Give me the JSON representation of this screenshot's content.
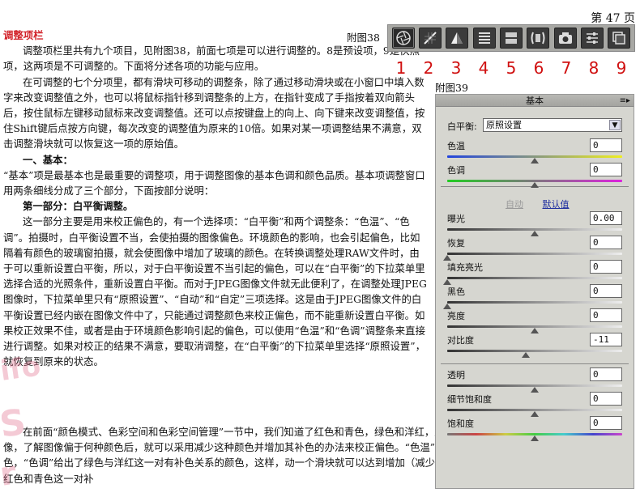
{
  "page_number": "第 47 页",
  "section_title": "调整项栏",
  "fig38_label": "附图38",
  "fig39_label": "附图39",
  "toolbar": {
    "icons": [
      "aperture-icon",
      "curve-icon",
      "sharpen-icon",
      "hsl-icon",
      "split-tone-icon",
      "lens-icon",
      "camera-icon",
      "presets-icon",
      "snapshots-icon"
    ],
    "numbers": [
      "1",
      "2",
      "3",
      "4",
      "5",
      "6",
      "7",
      "8",
      "9"
    ]
  },
  "paragraphs": {
    "p1": "调整项栏里共有九个项目，见附图38，前面七项是可以进行调整的。8是预设项，9是快照项，这两项是不可调整的。下面将分述各项的功能与应用。",
    "p2": "在可调整的七个分项里，都有滑块可移动的调整条，除了通过移动滑块或在小窗口中填入数字来改变调整值之外，也可以将鼠标指针移到调整条的上方，在指针变成了手指按着双向箭头后，按住鼠标左键移动鼠标来改变调整值。还可以点按键盘上的向上、向下键来改变调整值，按住Shift键后点按方向键，每次改变的调整值为原来的10倍。如果对某一项调整结果不满意，双击调整滑块就可以恢复这一项的原始值。",
    "h1": "一、基本：",
    "p3": "“基本”项是最基本也是最重要的调整项，用于调整图像的基本色调和颜色品质。基本项调整窗口用两条细线分成了三个部分，下面按部分说明：",
    "h2": "第一部分：白平衡调整。",
    "p4": "这一部分主要是用来校正偏色的，有一个选择项：“白平衡”和两个调整条：“色温”、“色调”。拍摄时，白平衡设置不当，会使拍摄的图像偏色。环境颜色的影响，也会引起偏色，比如隔着有颜色的玻璃窗拍摄，就会使图像中增加了玻璃的颜色。在转换调整处理RAW文件时，由于可以重新设置白平衡，所以，对于白平衡设置不当引起的偏色，可以在“白平衡”的下拉菜单里选择合适的光照条件，重新设置白平衡。而对于JPEG图像文件就无此便利了，在调整处理JPEG图像时，下拉菜单里只有“原照设置”、“自动”和“自定”三项选择。这是由于JPEG图像文件的白平衡设置已经内嵌在图像文件中了，只能通过调整颜色来校正偏色，而不能重新设置白平衡。如果校正效果不佳，或者是由于环境颜色影响引起的偏色，可以使用“色温”和“色调”调整条来直接进行调整。如果对校正的结果不满意，要取消调整，在“白平衡”的下拉菜单里选择“原照设置”，就恢复到原来的状态。",
    "p5": "在前面“颜色模式、色彩空间和色彩空间管理”一节中，我们知道了红色和青色，绿色和洋红，蓝色和黄色是补色关系。当我们通过观察图像，了解图像偏于何种颜色后，就可以采用减少这种颜色并增加其补色的办法来校正偏色。“色温”给出了蓝色与黄色这一对有补色关系的颜色，“色调”给出了绿色与洋红这一对有补色关系的颜色，这样，动一个滑块就可以达到增加（减少）颜色并减少（增加）其补色的效果。对于红色和青色这一对补"
  },
  "panel": {
    "title": "基本",
    "wb_label": "白平衡:",
    "wb_value": "原照设置",
    "auto_label": "自动",
    "default_label": "默认值",
    "sliders": [
      {
        "key": "temp",
        "label": "色温",
        "value": "0",
        "level": 0.5
      },
      {
        "key": "tint",
        "label": "色调",
        "value": "0",
        "level": 0.5
      },
      {
        "key": "exposure",
        "label": "曝光",
        "value": "0.00",
        "level": 0.5
      },
      {
        "key": "recovery",
        "label": "恢复",
        "value": "0",
        "level": 0.0
      },
      {
        "key": "fill",
        "label": "填充亮光",
        "value": "0",
        "level": 0.0
      },
      {
        "key": "blacks",
        "label": "黑色",
        "value": "0",
        "level": 0.0
      },
      {
        "key": "brightness",
        "label": "亮度",
        "value": "0",
        "level": 0.5
      },
      {
        "key": "contrast",
        "label": "对比度",
        "value": "-11",
        "level": 0.45
      },
      {
        "key": "clarity",
        "label": "透明",
        "value": "0",
        "level": 0.5
      },
      {
        "key": "vibrance",
        "label": "细节饱和度",
        "value": "0",
        "level": 0.5
      },
      {
        "key": "saturation",
        "label": "饱和度",
        "value": "0",
        "level": 0.5
      }
    ]
  }
}
